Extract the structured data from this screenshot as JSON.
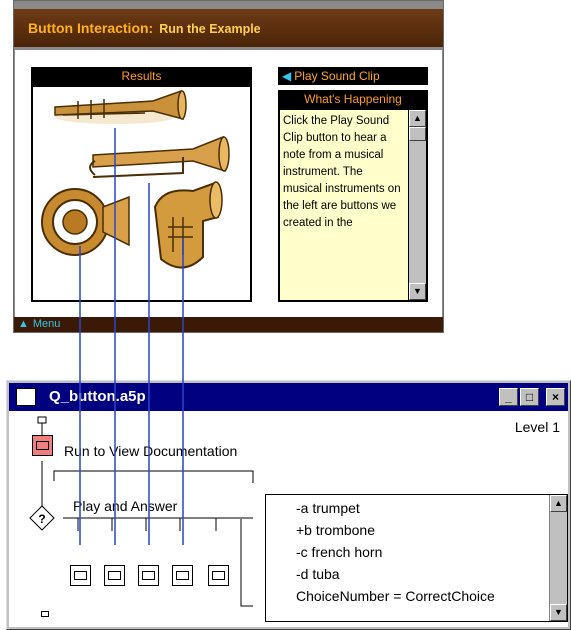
{
  "lesson": {
    "title_main": "Button Interaction:",
    "title_sub": "Run the Example",
    "results_label": "Results",
    "play_button_arrow": "◀",
    "play_button_label": "Play Sound Clip",
    "whats_happening_label": "What's Happening",
    "whats_happening_text": "Click the Play Sound Clip button to hear a note from a musical instrument. The musical instruments on the left are buttons we created in the",
    "menu_arrow": "▲",
    "menu_label": "Menu",
    "instruments": [
      "trumpet",
      "trombone",
      "french horn",
      "tuba"
    ],
    "colors": {
      "title_bg": "#5a2c0c",
      "title_text": "#ffb21a",
      "note_bg": "#ffffcc",
      "accent": "#36c6e8"
    }
  },
  "flow_window": {
    "title": "Q_button.a5p",
    "minimize_label": "_",
    "maximize_label": "□",
    "close_label": "×",
    "level": "Level 1",
    "run_doc_label": "Run to View Documentation",
    "play_answer_label": "Play and Answer",
    "decision_symbol": "?",
    "responses": [
      "-a trumpet",
      "+b trombone",
      "-c french horn",
      "-d tuba",
      "ChoiceNumber = CorrectChoice"
    ],
    "colors": {
      "titlebar": "#000080",
      "connector": "#2a45c8"
    }
  }
}
